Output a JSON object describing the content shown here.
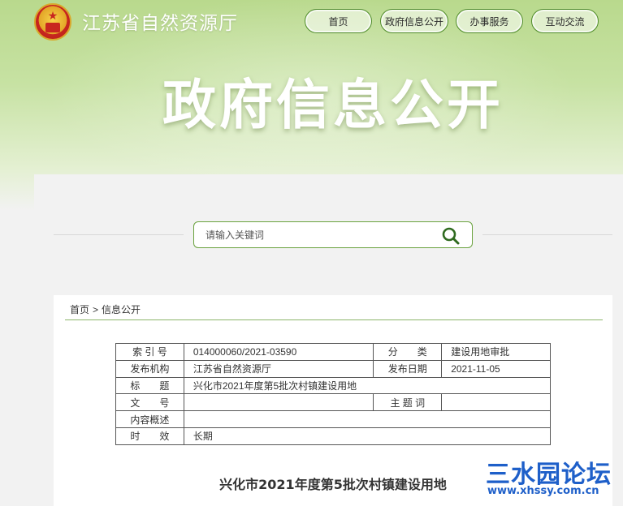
{
  "header": {
    "site_title": "江苏省自然资源厅",
    "nav": [
      {
        "label": "首页"
      },
      {
        "label": "政府信息公开"
      },
      {
        "label": "办事服务"
      },
      {
        "label": "互动交流"
      }
    ]
  },
  "banner": {
    "title": "政府信息公开"
  },
  "search": {
    "placeholder": "请输入关键词",
    "icon": "search-icon"
  },
  "breadcrumb": {
    "home": "首页",
    "separator": ">",
    "current": "信息公开"
  },
  "meta_table": {
    "index_label": "索 引 号",
    "index_value": "014000060/2021-03590",
    "category_label": "分　　类",
    "category_value": "建设用地审批",
    "publisher_label": "发布机构",
    "publisher_value": "江苏省自然资源厅",
    "date_label": "发布日期",
    "date_value": "2021-11-05",
    "title_label": "标　　题",
    "title_value": "兴化市2021年度第5批次村镇建设用地",
    "docno_label": "文　　号",
    "docno_value": "",
    "keywords_label": "主 题 词",
    "keywords_value": "",
    "summary_label": "内容概述",
    "summary_value": "",
    "validity_label": "时　　效",
    "validity_value": "长期"
  },
  "document": {
    "title": "兴化市2021年度第5批次村镇建设用地"
  },
  "watermark": {
    "main": "三水园论坛",
    "url": "www.xhssy.com.cn"
  },
  "colors": {
    "accent": "#6aa23e",
    "nav_border": "#4f8b2a",
    "watermark": "#1e5fc9"
  }
}
